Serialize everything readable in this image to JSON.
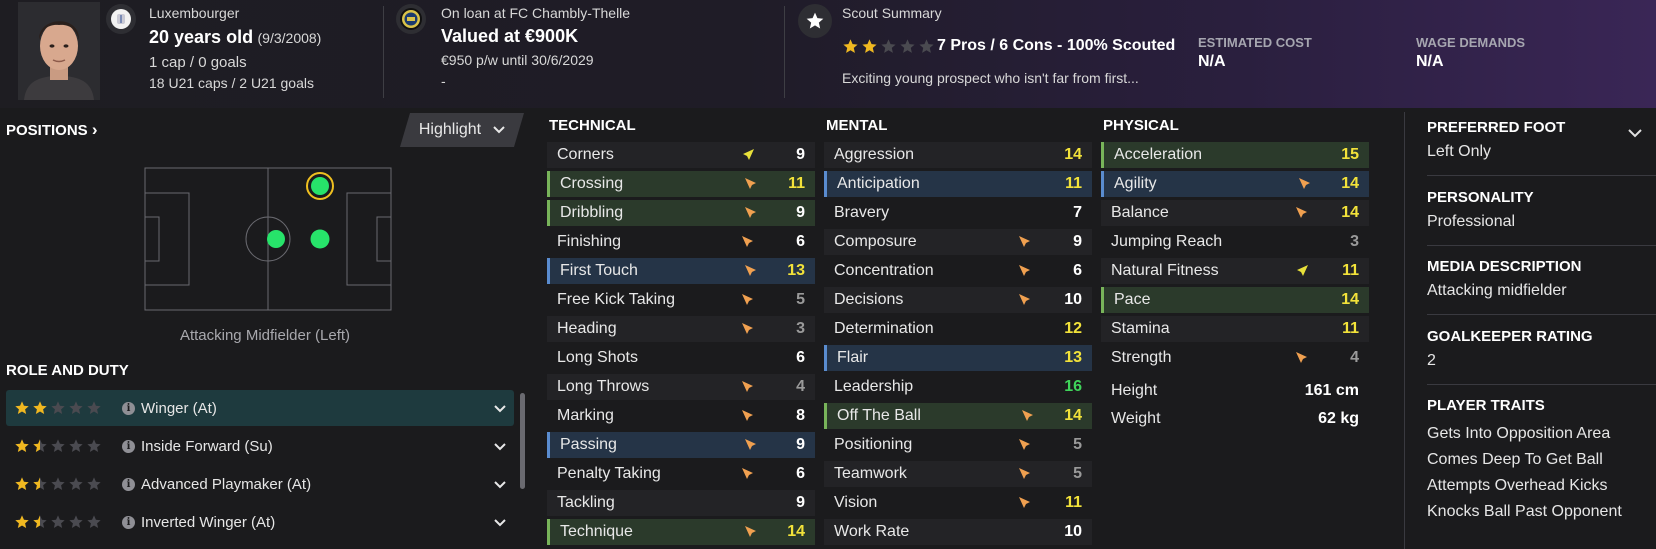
{
  "header": {
    "nationality": "Luxembourger",
    "age": "20 years old",
    "dob": "(9/3/2008)",
    "caps": "1 cap / 0 goals",
    "u21_caps": "18 U21 caps / 2 U21 goals",
    "loan": "On loan at FC Chambly-Thelle",
    "value": "Valued at €900K",
    "wage": "€950 p/w until 30/6/2029",
    "extra": "-",
    "scout_title": "Scout Summary",
    "scout_rating_stars": 2,
    "scout_summary": "7 Pros / 6 Cons - 100% Scouted",
    "scout_text": "Exciting young prospect who isn't far from first...",
    "estimated_cost_label": "ESTIMATED COST",
    "estimated_cost": "N/A",
    "wage_demands_label": "WAGE DEMANDS",
    "wage_demands": "N/A"
  },
  "positions": {
    "title": "POSITIONS",
    "title_arrow": "›",
    "highlight_label": "Highlight",
    "caption": "Attacking Midfielder (Left)"
  },
  "roles": {
    "title": "ROLE AND DUTY",
    "items": [
      {
        "label": "Winger (At)",
        "stars": 2
      },
      {
        "label": "Inside Forward (Su)",
        "stars": 1.5
      },
      {
        "label": "Advanced Playmaker (At)",
        "stars": 1.5
      },
      {
        "label": "Inverted Winger (At)",
        "stars": 1.5
      }
    ]
  },
  "technical": {
    "title": "TECHNICAL",
    "items": [
      {
        "name": "Corners",
        "value": "9",
        "arrow": "up",
        "style": "alt",
        "color": "white"
      },
      {
        "name": "Crossing",
        "value": "11",
        "arrow": "down",
        "style": "green",
        "color": "yellow"
      },
      {
        "name": "Dribbling",
        "value": "9",
        "arrow": "down",
        "style": "green",
        "color": "white"
      },
      {
        "name": "Finishing",
        "value": "6",
        "arrow": "down",
        "style": "",
        "color": "white"
      },
      {
        "name": "First Touch",
        "value": "13",
        "arrow": "down",
        "style": "blue",
        "color": "yellow"
      },
      {
        "name": "Free Kick Taking",
        "value": "5",
        "arrow": "down",
        "style": "",
        "color": "grey"
      },
      {
        "name": "Heading",
        "value": "3",
        "arrow": "down",
        "style": "alt",
        "color": "grey"
      },
      {
        "name": "Long Shots",
        "value": "6",
        "arrow": "",
        "style": "",
        "color": "white"
      },
      {
        "name": "Long Throws",
        "value": "4",
        "arrow": "down",
        "style": "alt",
        "color": "grey"
      },
      {
        "name": "Marking",
        "value": "8",
        "arrow": "down",
        "style": "",
        "color": "white"
      },
      {
        "name": "Passing",
        "value": "9",
        "arrow": "down",
        "style": "blue",
        "color": "white"
      },
      {
        "name": "Penalty Taking",
        "value": "6",
        "arrow": "down",
        "style": "",
        "color": "white"
      },
      {
        "name": "Tackling",
        "value": "9",
        "arrow": "",
        "style": "alt",
        "color": "white"
      },
      {
        "name": "Technique",
        "value": "14",
        "arrow": "down",
        "style": "green",
        "color": "yellow"
      }
    ]
  },
  "mental": {
    "title": "MENTAL",
    "items": [
      {
        "name": "Aggression",
        "value": "14",
        "arrow": "",
        "style": "alt",
        "color": "yellow"
      },
      {
        "name": "Anticipation",
        "value": "11",
        "arrow": "",
        "style": "blue",
        "color": "yellow"
      },
      {
        "name": "Bravery",
        "value": "7",
        "arrow": "",
        "style": "",
        "color": "white"
      },
      {
        "name": "Composure",
        "value": "9",
        "arrow": "down",
        "style": "alt",
        "color": "white"
      },
      {
        "name": "Concentration",
        "value": "6",
        "arrow": "down",
        "style": "",
        "color": "white"
      },
      {
        "name": "Decisions",
        "value": "10",
        "arrow": "down",
        "style": "alt",
        "color": "white"
      },
      {
        "name": "Determination",
        "value": "12",
        "arrow": "",
        "style": "",
        "color": "yellow"
      },
      {
        "name": "Flair",
        "value": "13",
        "arrow": "",
        "style": "blue",
        "color": "yellow"
      },
      {
        "name": "Leadership",
        "value": "16",
        "arrow": "",
        "style": "",
        "color": "green"
      },
      {
        "name": "Off The Ball",
        "value": "14",
        "arrow": "down",
        "style": "green",
        "color": "yellow"
      },
      {
        "name": "Positioning",
        "value": "5",
        "arrow": "down",
        "style": "",
        "color": "grey"
      },
      {
        "name": "Teamwork",
        "value": "5",
        "arrow": "down",
        "style": "alt",
        "color": "grey"
      },
      {
        "name": "Vision",
        "value": "11",
        "arrow": "down",
        "style": "",
        "color": "yellow"
      },
      {
        "name": "Work Rate",
        "value": "10",
        "arrow": "",
        "style": "alt",
        "color": "white"
      }
    ]
  },
  "physical": {
    "title": "PHYSICAL",
    "items": [
      {
        "name": "Acceleration",
        "value": "15",
        "arrow": "",
        "style": "green",
        "color": "yellow"
      },
      {
        "name": "Agility",
        "value": "14",
        "arrow": "down",
        "style": "blue",
        "color": "yellow"
      },
      {
        "name": "Balance",
        "value": "14",
        "arrow": "down",
        "style": "alt",
        "color": "yellow"
      },
      {
        "name": "Jumping Reach",
        "value": "3",
        "arrow": "",
        "style": "",
        "color": "grey"
      },
      {
        "name": "Natural Fitness",
        "value": "11",
        "arrow": "up",
        "style": "alt",
        "color": "yellow"
      },
      {
        "name": "Pace",
        "value": "14",
        "arrow": "",
        "style": "green",
        "color": "yellow"
      },
      {
        "name": "Stamina",
        "value": "11",
        "arrow": "",
        "style": "alt",
        "color": "yellow"
      },
      {
        "name": "Strength",
        "value": "4",
        "arrow": "down",
        "style": "",
        "color": "grey"
      }
    ],
    "height_label": "Height",
    "height": "161 cm",
    "weight_label": "Weight",
    "weight": "62 kg"
  },
  "side": {
    "foot_title": "PREFERRED FOOT",
    "foot": "Left Only",
    "personality_title": "PERSONALITY",
    "personality": "Professional",
    "media_title": "MEDIA DESCRIPTION",
    "media": "Attacking midfielder",
    "gk_title": "GOALKEEPER RATING",
    "gk": "2",
    "traits_title": "PLAYER TRAITS",
    "traits": [
      "Gets Into Opposition Area",
      "Comes Deep To Get Ball",
      "Attempts Overhead Kicks",
      "Knocks Ball Past Opponent"
    ]
  },
  "colors": {
    "accent_green": "#3fd45a",
    "yellow": "#f2e23a",
    "selected_row": "#1e3a3e",
    "star": "#f0b820"
  }
}
